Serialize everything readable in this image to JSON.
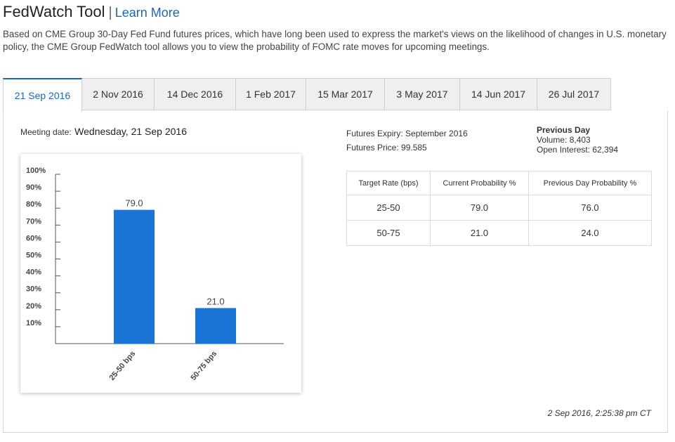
{
  "header": {
    "title": "FedWatch Tool",
    "separator": "|",
    "learn_more": "Learn More",
    "description": "Based on CME Group 30-Day Fed Fund futures prices, which have long been used to express the market's views on the likelihood of changes in U.S. monetary policy, the CME Group FedWatch tool allows you to view the probability of FOMC rate moves for upcoming meetings."
  },
  "tabs": [
    {
      "label": "21 Sep 2016",
      "active": true
    },
    {
      "label": "2 Nov 2016",
      "active": false
    },
    {
      "label": "14 Dec 2016",
      "active": false
    },
    {
      "label": "1 Feb 2017",
      "active": false
    },
    {
      "label": "15 Mar 2017",
      "active": false
    },
    {
      "label": "3 May 2017",
      "active": false
    },
    {
      "label": "14 Jun 2017",
      "active": false
    },
    {
      "label": "26 Jul 2017",
      "active": false
    }
  ],
  "meeting": {
    "label": "Meeting date:",
    "value": "Wednesday, 21 Sep 2016"
  },
  "futures": {
    "expiry": "Futures Expiry: September 2016",
    "price": "Futures Price: 99.585"
  },
  "previous_day": {
    "heading": "Previous Day",
    "volume": "Volume: 8,403",
    "open_interest": "Open Interest: 62,394"
  },
  "table": {
    "headers": [
      "Target Rate (bps)",
      "Current Probability %",
      "Previous Day Probability %"
    ],
    "rows": [
      [
        "25-50",
        "79.0",
        "76.0"
      ],
      [
        "50-75",
        "21.0",
        "24.0"
      ]
    ]
  },
  "chart_data": {
    "type": "bar",
    "categories": [
      "25-50 bps",
      "50-75 bps"
    ],
    "values": [
      79.0,
      21.0
    ],
    "data_labels": [
      "79.0",
      "21.0"
    ],
    "y_ticks": [
      "10%",
      "20%",
      "30%",
      "40%",
      "50%",
      "60%",
      "70%",
      "80%",
      "90%",
      "100%"
    ],
    "ylim": [
      0,
      100
    ],
    "bar_color": "#1b75d6",
    "title": "",
    "xlabel": "",
    "ylabel": "",
    "grid": false,
    "legend": "none"
  },
  "timestamp": "2 Sep 2016, 2:25:38 pm CT",
  "colors": {
    "accent": "#1d68b6",
    "bar": "#1b75d6",
    "tab_inactive": "#efefef"
  }
}
